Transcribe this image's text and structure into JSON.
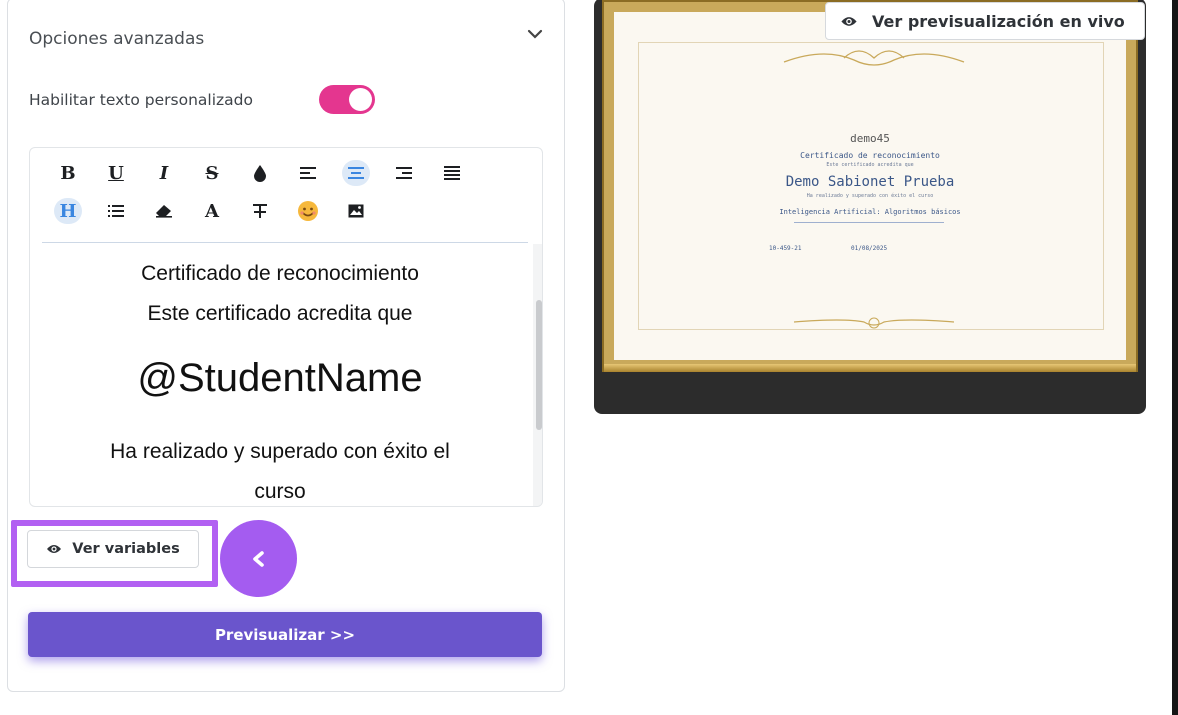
{
  "panel": {
    "title": "Opciones avanzadas",
    "toggle_label": "Habilitar texto personalizado",
    "toggle_on": true
  },
  "editor": {
    "toolbar": [
      "bold-icon",
      "underline-icon",
      "italic-icon",
      "strikethrough-icon",
      "color-drop-icon",
      "align-left-icon",
      "align-center-icon",
      "align-right-icon",
      "justify-icon",
      "heading-icon",
      "list-icon",
      "eraser-icon",
      "font-icon",
      "text-format-icon",
      "emoji-icon",
      "image-icon"
    ],
    "content": {
      "line1": "Certificado de reconocimiento",
      "line2": "Este certificado acredita que",
      "name": "@StudentName",
      "line3": "Ha realizado y superado con éxito el",
      "line4": "curso"
    }
  },
  "buttons": {
    "ver_variables": "Ver variables",
    "previsualizar": "Previsualizar >>",
    "ver_previsualizacion": "Ver previsualización en vivo"
  },
  "certificate": {
    "user": "demo45",
    "title": "Certificado de reconocimiento",
    "subtitle": "Este certificado acredita que",
    "name": "Demo Sabionet Prueba",
    "done": "Ha realizado y superado con éxito el curso",
    "course": "Inteligencia Artificial: Algoritmos básicos",
    "code": "10-459-21",
    "date": "01/08/2025"
  },
  "colors": {
    "toggle": "#e4368f",
    "accent_purple": "#6a55cc",
    "highlight": "#b260f2"
  }
}
